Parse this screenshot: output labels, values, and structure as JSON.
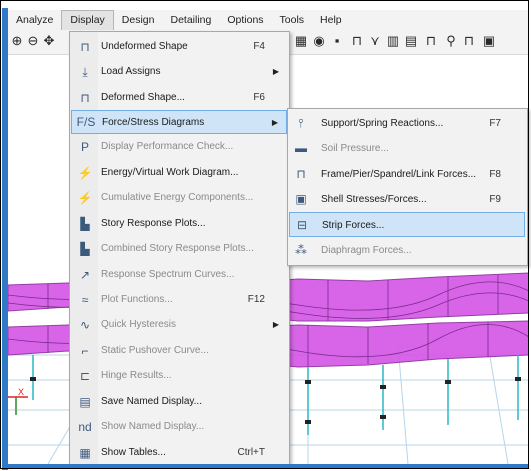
{
  "menubar": {
    "items": [
      "Analyze",
      "Display",
      "Design",
      "Detailing",
      "Options",
      "Tools",
      "Help"
    ],
    "open_item": "Display"
  },
  "display_menu": {
    "items": [
      {
        "label": "Undeformed Shape",
        "shortcut": "F4",
        "icon": "undeformed-icon",
        "enabled": true
      },
      {
        "label": "Load Assigns",
        "shortcut": "",
        "icon": "load-assigns-icon",
        "enabled": true,
        "submenu": true
      },
      {
        "label": "Deformed Shape...",
        "shortcut": "F6",
        "icon": "deformed-icon",
        "enabled": true
      },
      {
        "label": "Force/Stress Diagrams",
        "shortcut": "",
        "icon": "force-stress-icon",
        "enabled": true,
        "submenu": true,
        "highlighted": true
      },
      {
        "label": "Display Performance Check...",
        "shortcut": "",
        "icon": "performance-icon",
        "enabled": false
      },
      {
        "label": "Energy/Virtual Work Diagram...",
        "shortcut": "",
        "icon": "energy-icon",
        "enabled": true
      },
      {
        "label": "Cumulative Energy Components...",
        "shortcut": "",
        "icon": "cumulative-energy-icon",
        "enabled": false
      },
      {
        "label": "Story Response Plots...",
        "shortcut": "",
        "icon": "story-response-icon",
        "enabled": true
      },
      {
        "label": "Combined Story Response Plots...",
        "shortcut": "",
        "icon": "combined-story-icon",
        "enabled": false
      },
      {
        "label": "Response Spectrum Curves...",
        "shortcut": "",
        "icon": "spectrum-icon",
        "enabled": false
      },
      {
        "label": "Plot Functions...",
        "shortcut": "F12",
        "icon": "plot-functions-icon",
        "enabled": false
      },
      {
        "label": "Quick Hysteresis",
        "shortcut": "",
        "icon": "hysteresis-icon",
        "enabled": false,
        "submenu": true
      },
      {
        "label": "Static Pushover Curve...",
        "shortcut": "",
        "icon": "pushover-icon",
        "enabled": false
      },
      {
        "label": "Hinge Results...",
        "shortcut": "",
        "icon": "hinge-icon",
        "enabled": false
      },
      {
        "label": "Save Named Display...",
        "shortcut": "",
        "icon": "save-display-icon",
        "enabled": true
      },
      {
        "label": "Show Named Display...",
        "shortcut": "",
        "icon": "show-display-icon",
        "enabled": false
      },
      {
        "label": "Show Tables...",
        "shortcut": "Ctrl+T",
        "icon": "tables-icon",
        "enabled": true
      }
    ]
  },
  "force_submenu": {
    "items": [
      {
        "label": "Support/Spring Reactions...",
        "shortcut": "F7",
        "icon": "support-icon",
        "enabled": true
      },
      {
        "label": "Soil Pressure...",
        "shortcut": "",
        "icon": "soil-icon",
        "enabled": false
      },
      {
        "label": "Frame/Pier/Spandrel/Link Forces...",
        "shortcut": "F8",
        "icon": "frame-forces-icon",
        "enabled": true
      },
      {
        "label": "Shell Stresses/Forces...",
        "shortcut": "F9",
        "icon": "shell-icon",
        "enabled": true
      },
      {
        "label": "Strip Forces...",
        "shortcut": "",
        "icon": "strip-icon",
        "enabled": true,
        "highlighted": true
      },
      {
        "label": "Diaphragm Forces...",
        "shortcut": "",
        "icon": "diaphragm-icon",
        "enabled": false
      }
    ]
  },
  "colors": {
    "accent_border": "#2f79c6",
    "highlight_fill": "#cfe4f7",
    "highlight_border": "#74aee6",
    "strip_diagram": "#d455e6",
    "column_color": "#27b8c9"
  },
  "canvas": {
    "axis_label": "X"
  }
}
